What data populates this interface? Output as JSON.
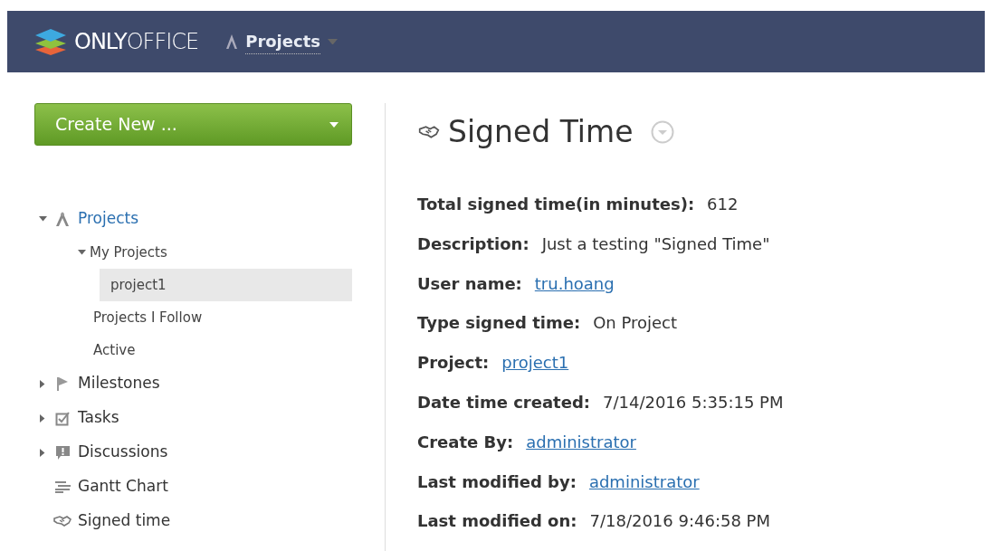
{
  "header": {
    "logo": "**ONLY**OFFICE",
    "module": "Projects"
  },
  "create_button": "Create New ...",
  "sidebar": {
    "items": [
      {
        "label": "Projects",
        "expanded": true,
        "selected": false,
        "children": [
          {
            "label": "My Projects",
            "expanded": true,
            "selected": false,
            "children": [
              {
                "label": "project1",
                "selected": true
              }
            ]
          },
          {
            "label": "Projects I Follow",
            "selected": false
          },
          {
            "label": "Active",
            "selected": false
          }
        ]
      },
      {
        "label": "Milestones",
        "expanded": false,
        "selected": false
      },
      {
        "label": "Tasks",
        "expanded": false,
        "selected": false
      },
      {
        "label": "Discussions",
        "expanded": false,
        "selected": false
      },
      {
        "label": "Gantt Chart",
        "selected": false
      },
      {
        "label": "Signed time",
        "selected": false
      }
    ]
  },
  "title": "Signed Time",
  "fields": [
    {
      "label": "Total signed time(in minutes):",
      "value": "612",
      "kind": "text"
    },
    {
      "label": "Description:",
      "value": "Just a testing \"Signed Time\"",
      "kind": "text"
    },
    {
      "label": "User name:",
      "value": "tru.hoang",
      "kind": "link"
    },
    {
      "label": "Type signed time:",
      "value": "On Project",
      "kind": "text"
    },
    {
      "label": "Project:",
      "value": "project1",
      "kind": "link"
    },
    {
      "label": "Date time created:",
      "value": "7/14/2016 5:35:15 PM",
      "kind": "text"
    },
    {
      "label": "Create By:",
      "value": "administrator",
      "kind": "link"
    },
    {
      "label": "Last modified by:",
      "value": "administrator",
      "kind": "link"
    },
    {
      "label": "Last modified on:",
      "value": "7/18/2016 9:46:58 PM",
      "kind": "text"
    }
  ]
}
